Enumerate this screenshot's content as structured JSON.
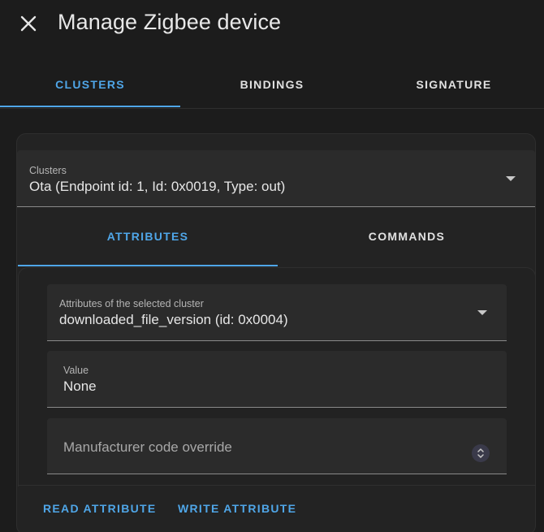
{
  "dialog": {
    "title": "Manage Zigbee device",
    "close_icon": "close-icon"
  },
  "tabs": [
    {
      "label": "CLUSTERS",
      "active": true
    },
    {
      "label": "BINDINGS",
      "active": false
    },
    {
      "label": "SIGNATURE",
      "active": false
    }
  ],
  "clusters_select": {
    "label": "Clusters",
    "value": "Ota (Endpoint id: 1, Id: 0x0019, Type: out)"
  },
  "subtabs": [
    {
      "label": "ATTRIBUTES",
      "active": true
    },
    {
      "label": "COMMANDS",
      "active": false
    }
  ],
  "attributes_select": {
    "label": "Attributes of the selected cluster",
    "value": "downloaded_file_version (id: 0x0004)"
  },
  "value_field": {
    "label": "Value",
    "value": "None"
  },
  "manufacturer_field": {
    "placeholder": "Manufacturer code override"
  },
  "actions": {
    "read_label": "READ ATTRIBUTE",
    "write_label": "WRITE ATTRIBUTE"
  },
  "colors": {
    "accent": "#4fa6e8",
    "background": "#1c1c1c",
    "card": "#232323",
    "field": "#2b2b2b"
  }
}
